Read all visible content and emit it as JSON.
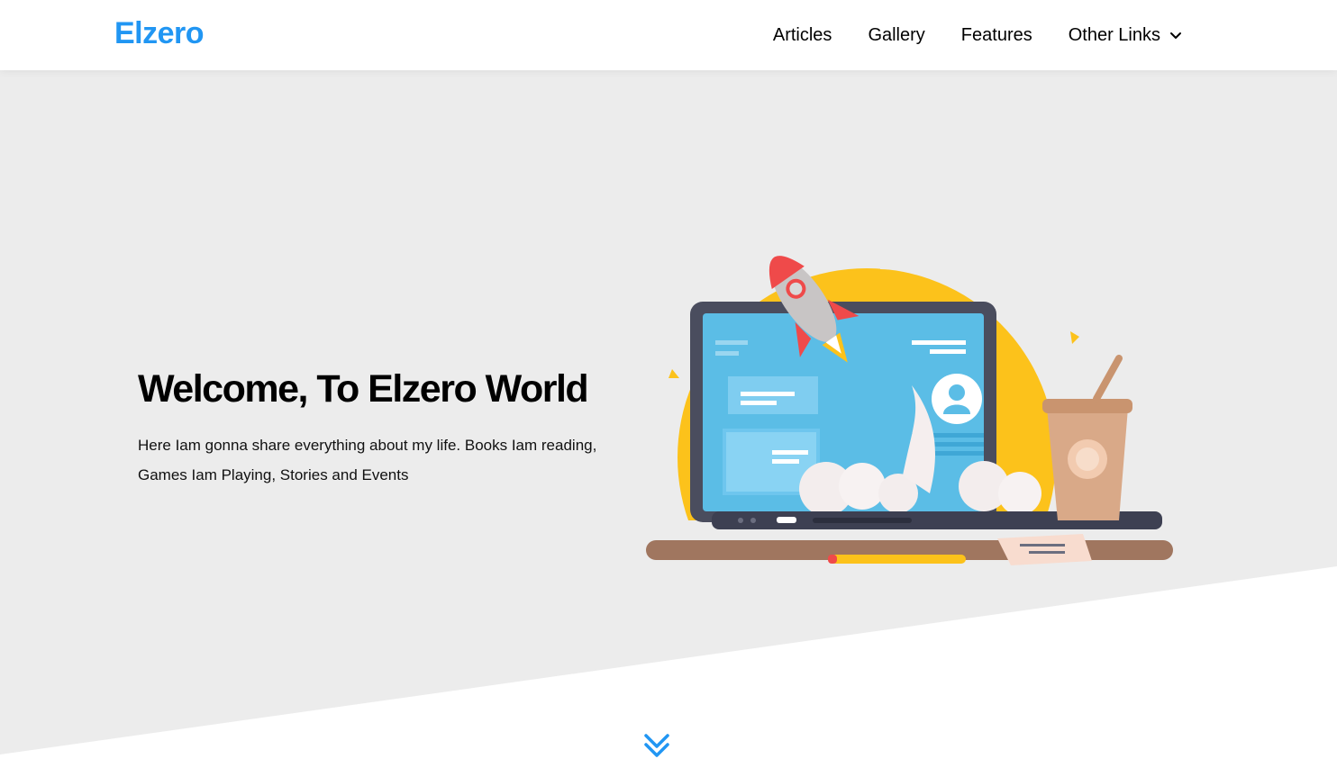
{
  "header": {
    "logo": "Elzero",
    "nav": [
      {
        "label": "Articles"
      },
      {
        "label": "Gallery"
      },
      {
        "label": "Features"
      },
      {
        "label": "Other Links",
        "icon": "chevron-down-icon"
      }
    ]
  },
  "landing": {
    "title": "Welcome, To Elzero World",
    "description": "Here Iam gonna share everything about my life. Books Iam reading, Games Iam Playing, Stories and Events",
    "illustration": "laptop-rocket-illustration",
    "scroll_icon": "double-chevron-down-icon"
  },
  "colors": {
    "brand": "#2196f3",
    "landing_bg": "#ececec",
    "text": "#000000"
  }
}
